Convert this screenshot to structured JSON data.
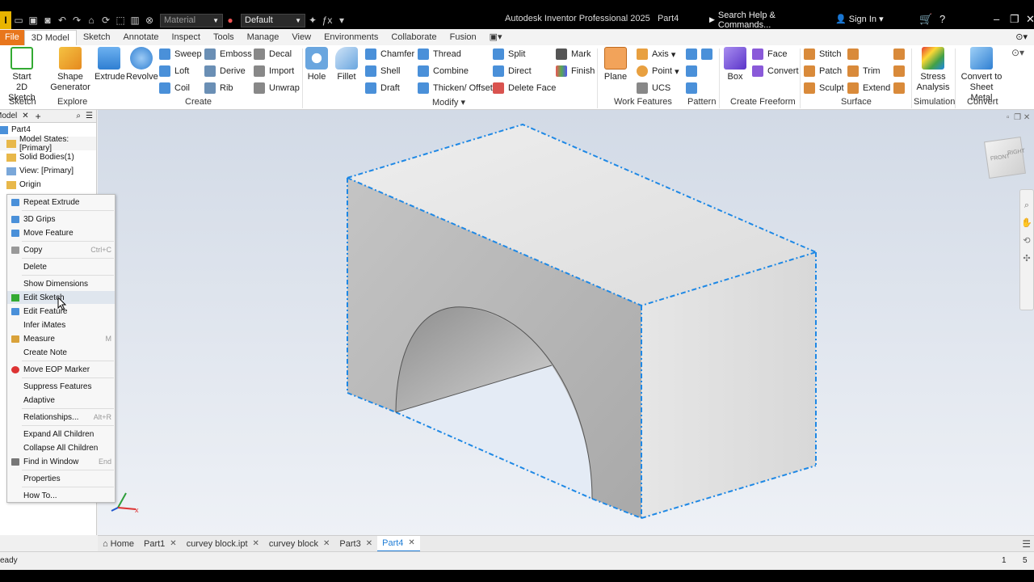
{
  "titlebar": {
    "material_placeholder": "Material",
    "appearance_value": "Default",
    "app_title": "Autodesk Inventor Professional 2025",
    "doc_name": "Part4",
    "search_placeholder": "Search Help & Commands...",
    "signin": "Sign In"
  },
  "menu_tabs": [
    "File",
    "3D Model",
    "Sketch",
    "Annotate",
    "Inspect",
    "Tools",
    "Manage",
    "View",
    "Environments",
    "Collaborate",
    "Fusion"
  ],
  "ribbon": {
    "start_sketch": "Start",
    "start_sketch2": "2D Sketch",
    "shape_gen": "Shape",
    "shape_gen2": "Generator",
    "extrude": "Extrude",
    "revolve": "Revolve",
    "sweep": "Sweep",
    "loft": "Loft",
    "coil": "Coil",
    "emboss": "Emboss",
    "derive": "Derive",
    "rib": "Rib",
    "decal": "Decal",
    "import": "Import",
    "unwrap": "Unwrap",
    "hole": "Hole",
    "fillet": "Fillet",
    "chamfer": "Chamfer",
    "shell": "Shell",
    "draft": "Draft",
    "thread": "Thread",
    "combine": "Combine",
    "thicken": "Thicken/ Offset",
    "split": "Split",
    "direct": "Direct",
    "delete_face": "Delete Face",
    "mark": "Mark",
    "finish": "Finish",
    "plane": "Plane",
    "axis": "Axis",
    "point": "Point",
    "ucs": "UCS",
    "box": "Box",
    "face": "Face",
    "convert": "Convert",
    "stitch": "Stitch",
    "patch": "Patch",
    "sculpt": "Sculpt",
    "trim": "Trim",
    "extend": "Extend",
    "stress": "Stress",
    "stress2": "Analysis",
    "convert_sm": "Convert to",
    "convert_sm2": "Sheet Metal",
    "groups": {
      "sketch": "Sketch",
      "explore": "Explore",
      "create": "Create",
      "modify": "Modify",
      "work": "Work Features",
      "pattern": "Pattern",
      "freeform": "Create Freeform",
      "surface": "Surface",
      "simulation": "Simulation",
      "convert": "Convert"
    }
  },
  "browser": {
    "tab": "Model",
    "root": "Part4",
    "nodes": [
      "Model States: [Primary]",
      "Solid Bodies(1)",
      "View: [Primary]",
      "Origin"
    ]
  },
  "context_menu": {
    "items": [
      {
        "label": "Repeat Extrude",
        "shortcut": ""
      },
      {
        "label": "3D Grips",
        "shortcut": ""
      },
      {
        "label": "Move Feature",
        "shortcut": ""
      },
      {
        "label": "Copy",
        "shortcut": "Ctrl+C"
      },
      {
        "label": "Delete",
        "shortcut": ""
      },
      {
        "label": "Show Dimensions",
        "shortcut": ""
      },
      {
        "label": "Edit Sketch",
        "shortcut": ""
      },
      {
        "label": "Edit Feature",
        "shortcut": ""
      },
      {
        "label": "Infer iMates",
        "shortcut": ""
      },
      {
        "label": "Measure",
        "shortcut": "M"
      },
      {
        "label": "Create Note",
        "shortcut": ""
      },
      {
        "label": "Move EOP Marker",
        "shortcut": ""
      },
      {
        "label": "Suppress Features",
        "shortcut": ""
      },
      {
        "label": "Adaptive",
        "shortcut": ""
      },
      {
        "label": "Relationships...",
        "shortcut": "Alt+R"
      },
      {
        "label": "Expand All Children",
        "shortcut": ""
      },
      {
        "label": "Collapse All Children",
        "shortcut": ""
      },
      {
        "label": "Find in Window",
        "shortcut": "End"
      },
      {
        "label": "Properties",
        "shortcut": ""
      },
      {
        "label": "How To...",
        "shortcut": ""
      }
    ]
  },
  "viewcube": {
    "front": "FRONT",
    "right": "RIGHT"
  },
  "doc_tabs": [
    "Home",
    "Part1",
    "curvey block.ipt",
    "curvey block",
    "Part3",
    "Part4"
  ],
  "status": {
    "left": "eady",
    "count1": "1",
    "count2": "5"
  },
  "colors": {
    "accent": "#1f7dd6",
    "file_tab": "#e8761c",
    "edge_highlight": "#1e88e5"
  }
}
